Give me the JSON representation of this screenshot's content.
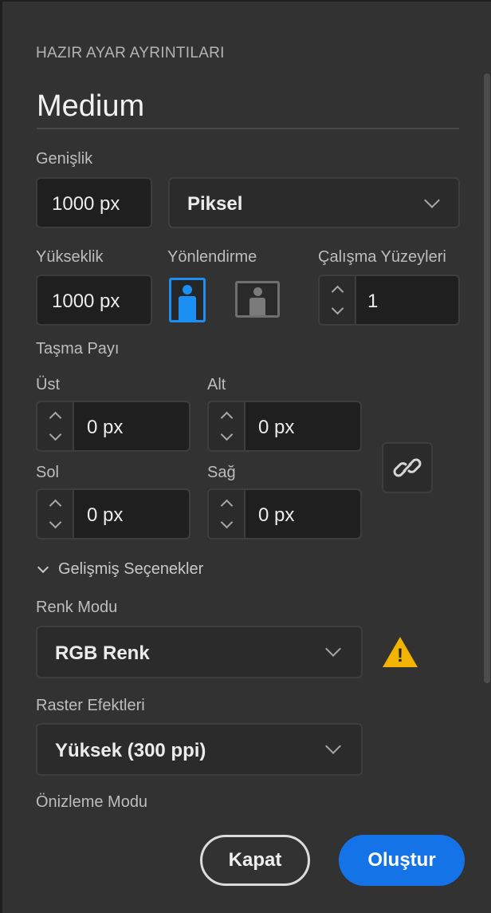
{
  "section_title": "HAZIR AYAR AYRINTILARI",
  "preset_name": "Medium",
  "width": {
    "label": "Genişlik",
    "value": "1000 px",
    "unit": "Piksel"
  },
  "height": {
    "label": "Yükseklik",
    "value": "1000 px"
  },
  "orientation": {
    "label": "Yönlendirme",
    "selected": "portrait"
  },
  "artboards": {
    "label": "Çalışma Yüzeyleri",
    "value": "1"
  },
  "bleed": {
    "label": "Taşma Payı",
    "top": {
      "label": "Üst",
      "value": "0 px"
    },
    "bottom": {
      "label": "Alt",
      "value": "0 px"
    },
    "left": {
      "label": "Sol",
      "value": "0 px"
    },
    "right": {
      "label": "Sağ",
      "value": "0 px"
    }
  },
  "advanced": {
    "label": "Gelişmiş Seçenekler",
    "expanded": true
  },
  "color_mode": {
    "label": "Renk Modu",
    "value": "RGB Renk",
    "warning": "warning-icon"
  },
  "raster_effects": {
    "label": "Raster Efektleri",
    "value": "Yüksek (300 ppi)"
  },
  "preview_mode": {
    "label": "Önizleme Modu"
  },
  "buttons": {
    "close": "Kapat",
    "create": "Oluştur"
  },
  "colors": {
    "accent": "#1473e6",
    "orientation_selected": "#1b8ff4",
    "warning": "#f2b400",
    "background": "#323232"
  }
}
